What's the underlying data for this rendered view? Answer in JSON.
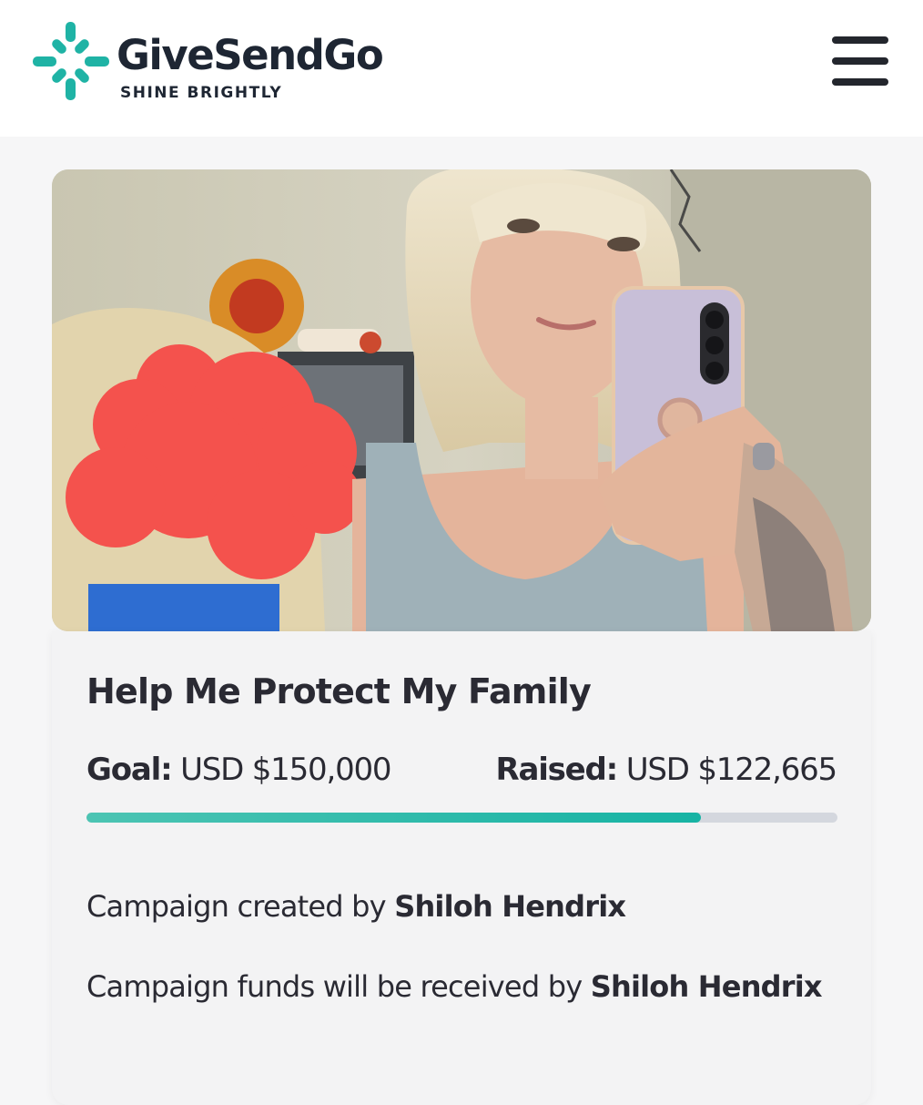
{
  "header": {
    "brand_name": "GiveSendGo",
    "tagline": "SHINE BRIGHTLY",
    "brand_color": "#1fb3a5",
    "menu_icon": "hamburger-menu-icon"
  },
  "campaign": {
    "title": "Help Me Protect My Family",
    "goal_label": "Goal:",
    "goal_value": "USD $150,000",
    "raised_label": "Raised:",
    "raised_value": "USD $122,665",
    "progress_fraction": 0.8178,
    "created_by_prefix": "Campaign created by",
    "created_by_name": "Shiloh Hendrix",
    "funds_prefix": "Campaign funds will be received by",
    "funds_name": "Shiloh Hendrix"
  },
  "colors": {
    "progress_fill": "#1fb3a5",
    "progress_track": "#d4d7de",
    "redaction": "#f4524d"
  }
}
